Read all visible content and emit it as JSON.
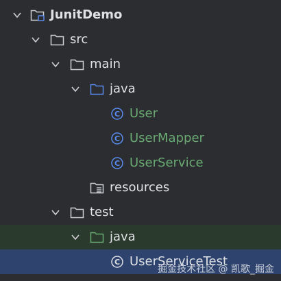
{
  "colors": {
    "background": "#2b2d30",
    "text": "#dfe1e5",
    "class_text": "#6aab73",
    "class_icon": "#5a8cf0",
    "java_source_folder": "#5a8cf0",
    "java_test_folder": "#6aab73",
    "selected_row": "#2e436e",
    "hover_row": "#2a3a2c"
  },
  "tree": {
    "project": {
      "label": "JunitDemo",
      "icon": "project-module-icon",
      "expanded": true
    },
    "src": {
      "label": "src",
      "icon": "folder-icon",
      "expanded": true
    },
    "main": {
      "label": "main",
      "icon": "folder-icon",
      "expanded": true
    },
    "main_java": {
      "label": "java",
      "icon": "source-root-folder-icon",
      "expanded": true
    },
    "user": {
      "label": "User",
      "icon": "java-class-icon"
    },
    "user_mapper": {
      "label": "UserMapper",
      "icon": "java-class-icon"
    },
    "user_service": {
      "label": "UserService",
      "icon": "java-class-icon"
    },
    "resources": {
      "label": "resources",
      "icon": "resources-folder-icon"
    },
    "test": {
      "label": "test",
      "icon": "folder-icon",
      "expanded": true
    },
    "test_java": {
      "label": "java",
      "icon": "test-root-folder-icon",
      "expanded": true
    },
    "user_service_test": {
      "label": "UserServiceTest",
      "icon": "java-class-icon",
      "selected": true
    }
  },
  "watermark": "掘金技术社区 @ 凯歌_掘金"
}
